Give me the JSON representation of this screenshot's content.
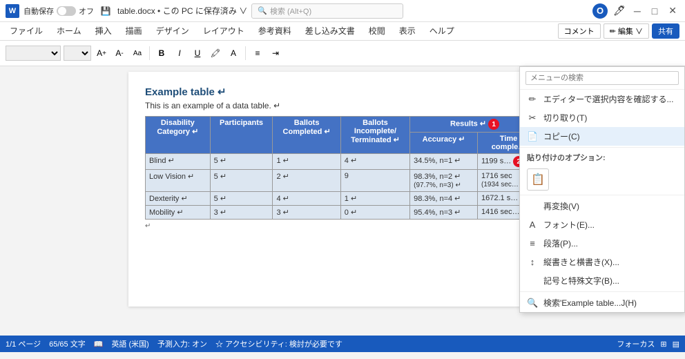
{
  "titlebar": {
    "autosave_label": "自動保存",
    "toggle_state": "オフ",
    "save_icon": "💾",
    "filename": "table.docx • この PC に保存済み ∨",
    "search_placeholder": "検索 (Alt+Q)",
    "office_label": "Office",
    "close": "✕",
    "maximize": "□",
    "minimize": "─"
  },
  "ribbon": {
    "tabs": [
      "ファイル",
      "ホーム",
      "挿入",
      "描画",
      "デザイン",
      "レイアウト",
      "参考資料",
      "差し込み文書",
      "校閲",
      "表示",
      "ヘルプ"
    ],
    "formatting": {
      "font": "",
      "size": "",
      "bold": "B",
      "italic": "I",
      "underline": "U"
    },
    "right_buttons": [
      "コメント",
      "編集",
      "共有"
    ]
  },
  "document": {
    "title": "Example table ↵",
    "subtitle": "This is an example of a data table. ↵",
    "table": {
      "headers": [
        "Disability Category ↵",
        "Participants",
        "Ballots Completed ↵",
        "Ballots Incomplete/ Terminated ↵",
        "Results ↵"
      ],
      "subheaders": [
        "Accuracy ↵",
        "Time comple…"
      ],
      "rows": [
        [
          "Blind ↵",
          "5 ↵",
          "1 ↵",
          "4 ↵",
          "34.5%, n=1 ↵",
          "1199 s…"
        ],
        [
          "Low Vision ↵",
          "5 ↵",
          "2 ↵",
          "9",
          "98.3%, n=2 ↵\n(97.7%, n=3) ↵",
          "1716 sec\n(1934 sec…"
        ],
        [
          "Dexterity ↵",
          "5 ↵",
          "4 ↵",
          "1 ↵",
          "98.3%, n=4 ↵",
          "1672.1 s…"
        ],
        [
          "Mobility ↵",
          "3 ↵",
          "3 ↵",
          "0 ↵",
          "95.4%, n=3 ↵",
          "1416 sec…"
        ]
      ]
    }
  },
  "context_menu": {
    "search_placeholder": "メニューの検索",
    "items": [
      {
        "icon": "✏️",
        "label": "エディターで選択内容を確認する..."
      },
      {
        "icon": "✂",
        "label": "切り取り(T)"
      },
      {
        "icon": "📄",
        "label": "コピー(C)",
        "badge": "2"
      },
      {
        "label": "貼り付けのオプション:",
        "type": "section"
      },
      {
        "label": "再変換(V)"
      },
      {
        "icon": "A",
        "label": "フォント(E)..."
      },
      {
        "icon": "≡",
        "label": "段落(P)..."
      },
      {
        "icon": "↕",
        "label": "縦書きと横書き(X)..."
      },
      {
        "label": "記号と特殊文字(B)..."
      },
      {
        "icon": "🔍",
        "label": "検索'Example table...J(H)"
      }
    ]
  },
  "statusbar": {
    "page": "1/1 ページ",
    "chars": "65/65 文字",
    "lang": "英語 (米国)",
    "prediction": "予測入力: オン",
    "accessibility": "☆ アクセシビリティ: 検討が必要です",
    "focus": "フォーカス"
  }
}
